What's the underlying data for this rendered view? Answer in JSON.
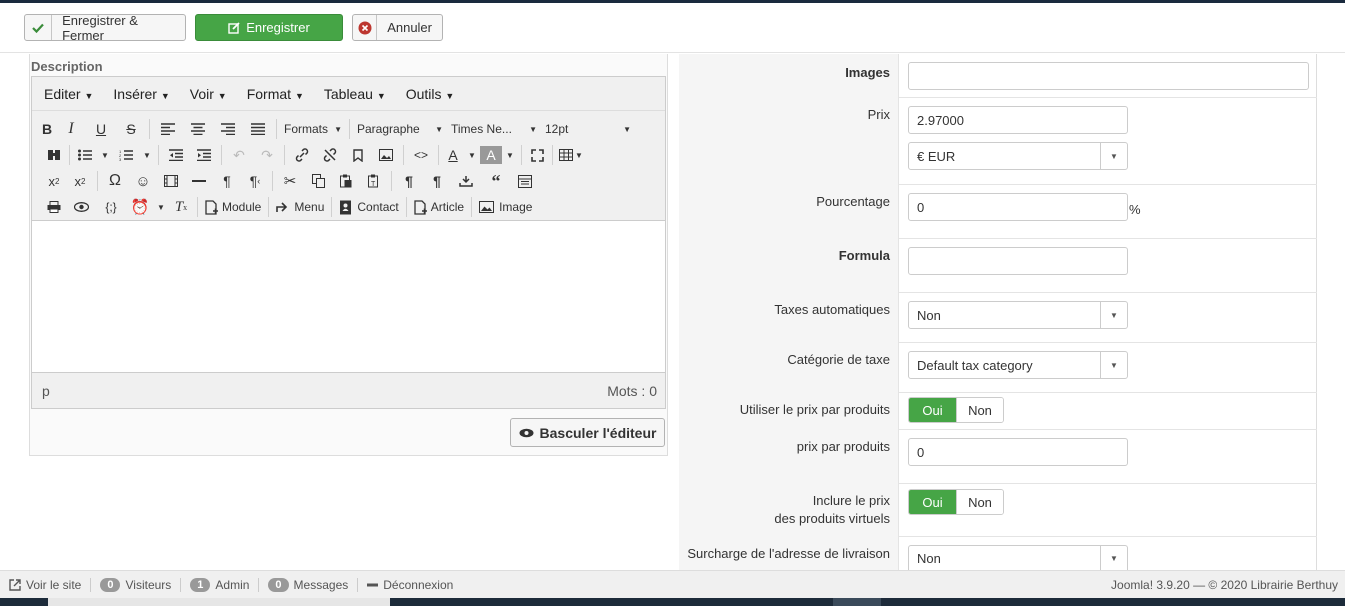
{
  "toolbar": {
    "save_close_label": "Enregistrer & Fermer",
    "save_label": "Enregistrer",
    "cancel_label": "Annuler"
  },
  "editor": {
    "label": "Description",
    "menu": [
      "Editer",
      "Insérer",
      "Voir",
      "Format",
      "Tableau",
      "Outils"
    ],
    "formats_label": "Formats",
    "block_label": "Paragraphe",
    "font_label": "Times Ne...",
    "size_label": "12pt",
    "insert_module": "Module",
    "insert_menu": "Menu",
    "insert_contact": "Contact",
    "insert_article": "Article",
    "insert_image": "Image",
    "path": "p",
    "word_count": "Mots : 0",
    "toggle_label": "Basculer l'éditeur"
  },
  "form": {
    "images_label": "Images",
    "images_value": "",
    "price_label": "Prix",
    "price_value": "2.97000",
    "currency_value": "€ EUR",
    "percent_label": "Pourcentage",
    "percent_value": "0",
    "percent_unit": "%",
    "formula_label": "Formula",
    "formula_value": "",
    "auto_tax_label": "Taxes automatiques",
    "auto_tax_value": "Non",
    "tax_cat_label": "Catégorie de taxe",
    "tax_cat_value": "Default tax category",
    "use_price_label": "Utiliser le prix par produits",
    "yes": "Oui",
    "no": "Non",
    "price_per_label": "prix par produits",
    "price_per_value": "0",
    "include_price_line1": "Inclure le prix",
    "include_price_line2": "des produits virtuels",
    "shipping_label": "Surcharge de l'adresse de livraison",
    "shipping_value": "Non"
  },
  "footer": {
    "view_site": "Voir le site",
    "visitors_count": "0",
    "visitors_label": "Visiteurs",
    "admin_count": "1",
    "admin_label": "Admin",
    "messages_count": "0",
    "messages_label": "Messages",
    "logout": "Déconnexion",
    "copyright": "Joomla! 3.9.20 — © 2020 Librairie Berthuy"
  },
  "colors": {
    "green": "#46a546",
    "dark_bar": "#1a2a3e"
  }
}
